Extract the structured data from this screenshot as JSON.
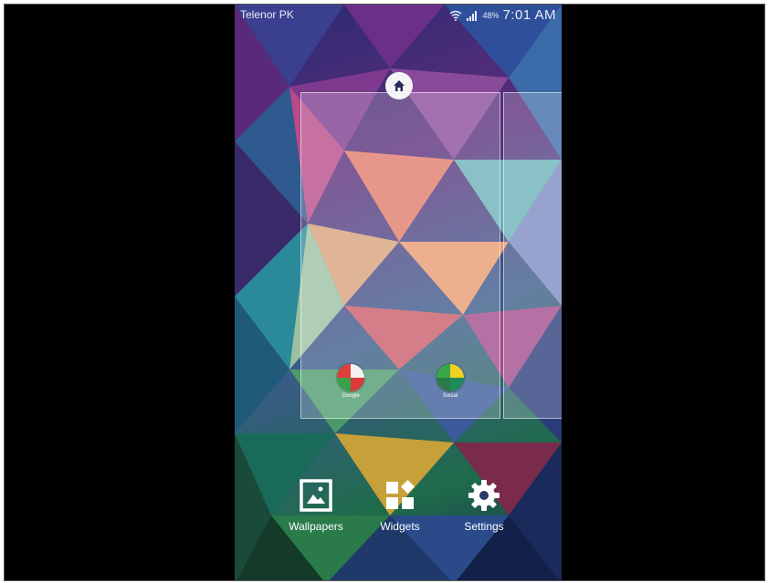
{
  "status_bar": {
    "carrier": "Telenor PK",
    "battery": "48%",
    "time": "7:01 AM"
  },
  "home_screen_editor": {
    "folders": [
      {
        "label": "Google"
      },
      {
        "label": "Social"
      }
    ]
  },
  "actions": [
    {
      "label": "Wallpapers",
      "icon": "wallpaper-icon"
    },
    {
      "label": "Widgets",
      "icon": "widgets-icon"
    },
    {
      "label": "Settings",
      "icon": "gear-icon"
    }
  ],
  "colors": {
    "frame_background": "#000000",
    "icon_white": "#ffffff"
  }
}
